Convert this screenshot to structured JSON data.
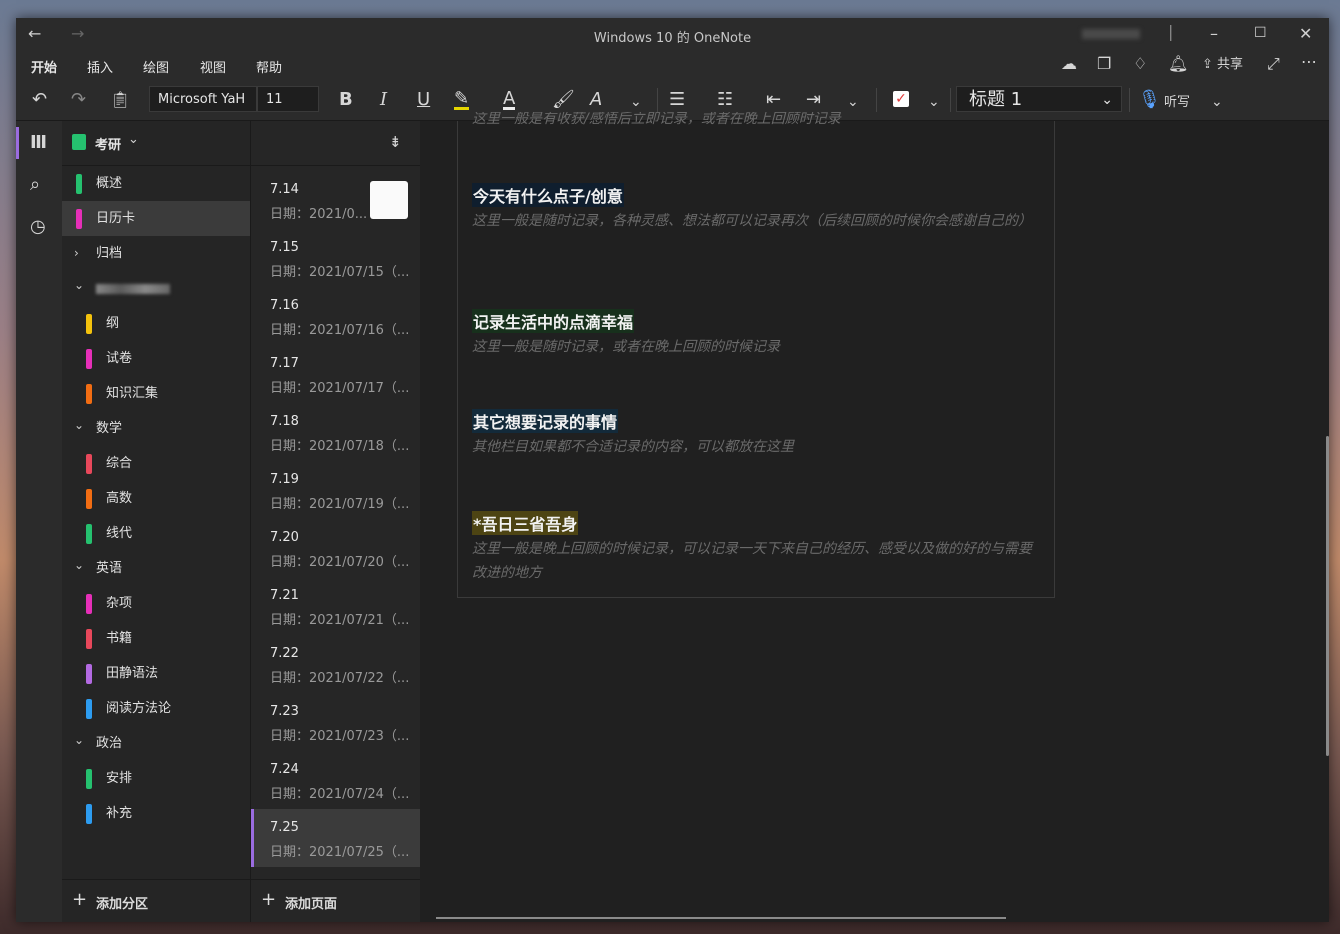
{
  "window": {
    "title": "Windows 10 的 OneNote"
  },
  "menu": [
    "开始",
    "插入",
    "绘图",
    "视图",
    "帮助"
  ],
  "toolbar": {
    "font": "Microsoft YaH",
    "size": "11",
    "style": "标题 1",
    "share": "共享",
    "dictate": "听写"
  },
  "notebook": {
    "name": "考研",
    "add_section": "添加分区",
    "add_page": "添加页面"
  },
  "sections": [
    {
      "label": "概述",
      "color": "#25c16f",
      "indent": 0
    },
    {
      "label": "日历卡",
      "color": "#e62fb8",
      "indent": 0,
      "selected": true
    },
    {
      "label": "归档",
      "chevron": "›",
      "indent": 0
    },
    {
      "label": "",
      "chevron": "⌄",
      "blurred": true,
      "indent": 0
    },
    {
      "label": "纲",
      "color": "#f4c20d",
      "indent": 1
    },
    {
      "label": "试卷",
      "color": "#e62fb8",
      "indent": 1
    },
    {
      "label": "知识汇集",
      "color": "#f26d13",
      "indent": 1
    },
    {
      "label": "数学",
      "chevron": "⌄",
      "indent": 0
    },
    {
      "label": "综合",
      "color": "#e8485b",
      "indent": 1
    },
    {
      "label": "高数",
      "color": "#f26d13",
      "indent": 1
    },
    {
      "label": "线代",
      "color": "#25c16f",
      "indent": 1
    },
    {
      "label": "英语",
      "chevron": "⌄",
      "indent": 0
    },
    {
      "label": "杂项",
      "color": "#e62fb8",
      "indent": 1
    },
    {
      "label": "书籍",
      "color": "#e8485b",
      "indent": 1
    },
    {
      "label": "田静语法",
      "color": "#b36ae2",
      "indent": 1
    },
    {
      "label": "阅读方法论",
      "color": "#2d9cf0",
      "indent": 1
    },
    {
      "label": "政治",
      "chevron": "⌄",
      "indent": 0
    },
    {
      "label": "安排",
      "color": "#25c16f",
      "indent": 1
    },
    {
      "label": "补充",
      "color": "#2d9cf0",
      "indent": 1
    }
  ],
  "pages": [
    {
      "title": "7.14",
      "date": "日期：2021/0...",
      "thumb": true
    },
    {
      "title": "7.15",
      "date": "日期：2021/07/15（..."
    },
    {
      "title": "7.16",
      "date": "日期：2021/07/16（..."
    },
    {
      "title": "7.17",
      "date": "日期：2021/07/17（..."
    },
    {
      "title": "7.18",
      "date": "日期：2021/07/18（..."
    },
    {
      "title": "7.19",
      "date": "日期：2021/07/19（..."
    },
    {
      "title": "7.20",
      "date": "日期：2021/07/20（..."
    },
    {
      "title": "7.21",
      "date": "日期：2021/07/21（..."
    },
    {
      "title": "7.22",
      "date": "日期：2021/07/22（..."
    },
    {
      "title": "7.23",
      "date": "日期：2021/07/23（..."
    },
    {
      "title": "7.24",
      "date": "日期：2021/07/24（..."
    },
    {
      "title": "7.25",
      "date": "日期：2021/07/25（...",
      "selected": true
    }
  ],
  "note": {
    "top_cut": "这里一般是有收获/感悟后立即记录，或者在晚上回顾时记录",
    "blocks": [
      {
        "heading": "今天有什么点子/创意",
        "hl": "#0f1e2e",
        "text": "这里一般是随时记录，各种灵感、想法都可以记录再次（后续回顾的时候你会感谢自己的）"
      },
      {
        "heading": "记录生活中的点滴幸福",
        "hl": "#17301c",
        "text": "这里一般是随时记录，或者在晚上回顾的时候记录"
      },
      {
        "heading": "其它想要记录的事情",
        "hl": "#132a3a",
        "text": "其他栏目如果都不合适记录的内容，可以都放在这里"
      },
      {
        "heading": "*吾日三省吾身",
        "hl": "#4d4413",
        "text": "这里一般是晚上回顾的时候记录，可以记录一天下来自己的经历、感受以及做的好的与需要改进的地方"
      }
    ]
  }
}
